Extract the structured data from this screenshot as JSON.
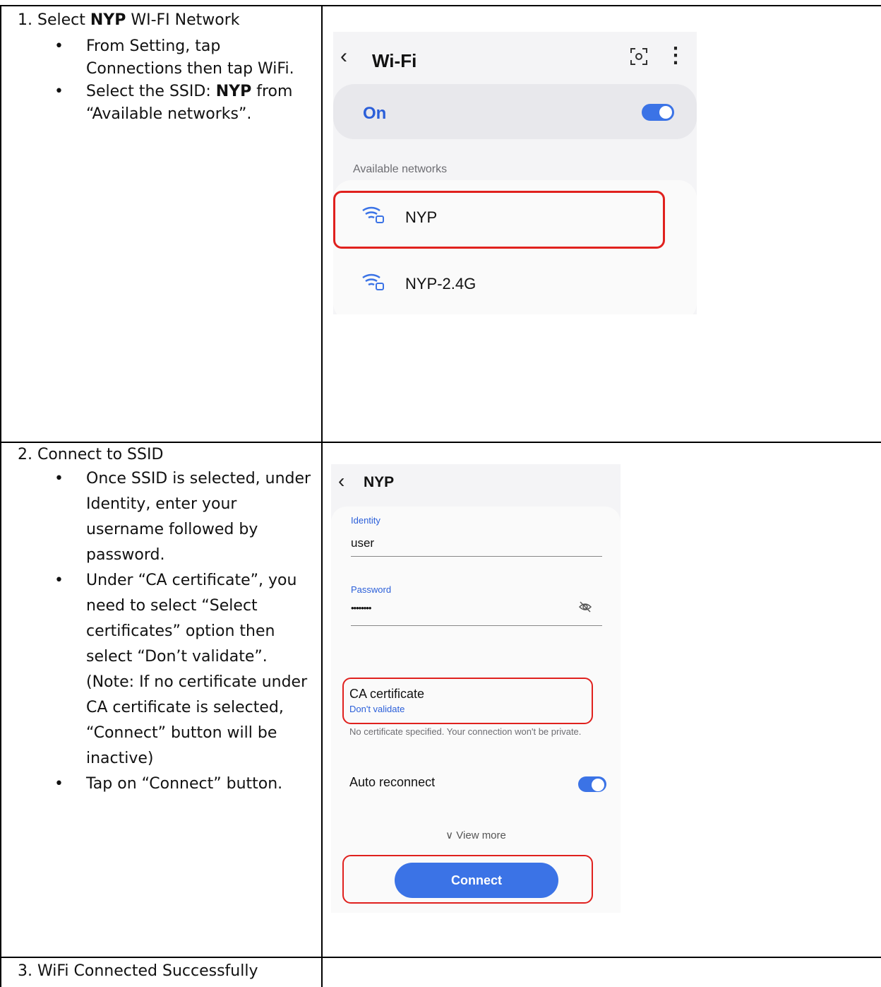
{
  "steps": [
    {
      "title_prefix": "1. Select ",
      "title_bold": "NYP",
      "title_suffix": " WI-FI Network",
      "bullets": [
        {
          "text": "From Setting, tap Connections then tap WiFi."
        },
        {
          "pre": "Select the SSID: ",
          "bold": "NYP",
          "post": " from “Available networks”."
        }
      ]
    },
    {
      "title": "2. Connect to SSID",
      "bullets": [
        "Once SSID is selected, under Identity, enter your username followed by password.",
        "Under “CA certificate”, you need to select “Select certificates” option then select “Don’t validate”. (Note: If no certificate under CA certificate is selected, “Connect” button will be inactive)",
        "Tap on “Connect” button."
      ]
    },
    {
      "title": "3. WiFi Connected Successfully"
    }
  ],
  "wifi_screen": {
    "back_icon": "chevron-left-icon",
    "title": "Wi-Fi",
    "on_label": "On",
    "toggle_on": true,
    "section_label": "Available networks",
    "networks": [
      "NYP",
      "NYP-2.4G"
    ],
    "highlighted_network": "NYP",
    "accent": "#3b73e6",
    "highlight_color": "#e0211e"
  },
  "connect_screen": {
    "title": "NYP",
    "identity_label": "Identity",
    "identity_value": "user",
    "password_label": "Password",
    "password_value": "••••••••",
    "ca_label": "CA certificate",
    "ca_value": "Don't validate",
    "ca_note": "No certificate specified. Your connection won't be private.",
    "auto_reconnect_label": "Auto reconnect",
    "auto_reconnect_on": true,
    "view_more": "View more",
    "connect_button": "Connect"
  }
}
